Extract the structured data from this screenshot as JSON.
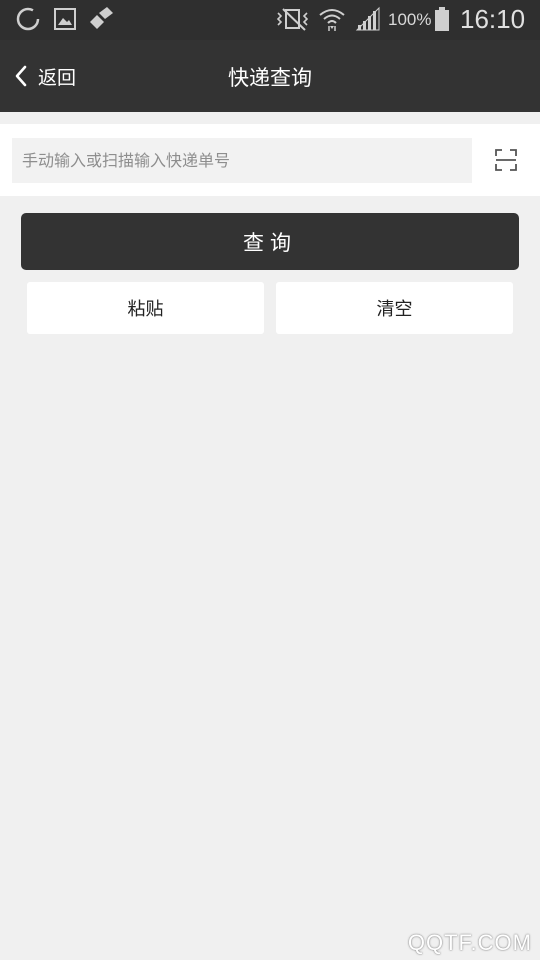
{
  "status_bar": {
    "battery_percent": "100%",
    "time": "16:10",
    "icons": [
      "loading-icon",
      "image-icon",
      "brush-icon",
      "vibrate-icon",
      "wifi-icon",
      "signal-icon",
      "battery-icon"
    ]
  },
  "toolbar": {
    "back_label": "返回",
    "title": "快递查询"
  },
  "search": {
    "placeholder": "手动输入或扫描输入快递单号",
    "value": ""
  },
  "actions": {
    "query_label": "查询",
    "paste_label": "粘贴",
    "clear_label": "清空"
  },
  "watermark": "QQTF.COM",
  "colors": {
    "bar": "#333333",
    "background": "#f0f0f0",
    "panel": "#ffffff"
  }
}
